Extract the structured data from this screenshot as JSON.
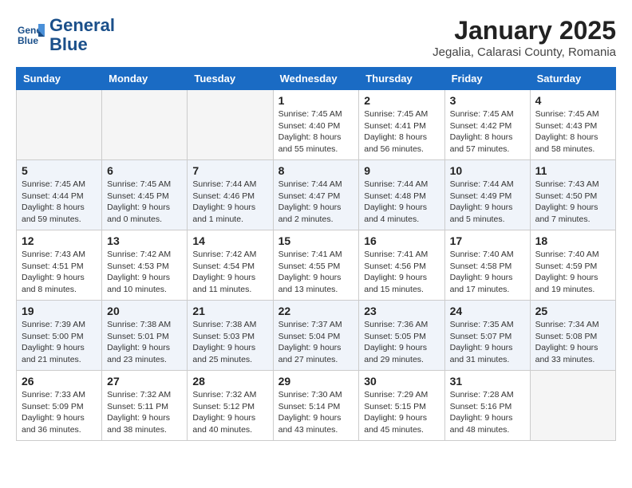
{
  "header": {
    "logo_line1": "General",
    "logo_line2": "Blue",
    "month": "January 2025",
    "location": "Jegalia, Calarasi County, Romania"
  },
  "weekdays": [
    "Sunday",
    "Monday",
    "Tuesday",
    "Wednesday",
    "Thursday",
    "Friday",
    "Saturday"
  ],
  "weeks": [
    [
      {
        "day": "",
        "info": ""
      },
      {
        "day": "",
        "info": ""
      },
      {
        "day": "",
        "info": ""
      },
      {
        "day": "1",
        "info": "Sunrise: 7:45 AM\nSunset: 4:40 PM\nDaylight: 8 hours\nand 55 minutes."
      },
      {
        "day": "2",
        "info": "Sunrise: 7:45 AM\nSunset: 4:41 PM\nDaylight: 8 hours\nand 56 minutes."
      },
      {
        "day": "3",
        "info": "Sunrise: 7:45 AM\nSunset: 4:42 PM\nDaylight: 8 hours\nand 57 minutes."
      },
      {
        "day": "4",
        "info": "Sunrise: 7:45 AM\nSunset: 4:43 PM\nDaylight: 8 hours\nand 58 minutes."
      }
    ],
    [
      {
        "day": "5",
        "info": "Sunrise: 7:45 AM\nSunset: 4:44 PM\nDaylight: 8 hours\nand 59 minutes."
      },
      {
        "day": "6",
        "info": "Sunrise: 7:45 AM\nSunset: 4:45 PM\nDaylight: 9 hours\nand 0 minutes."
      },
      {
        "day": "7",
        "info": "Sunrise: 7:44 AM\nSunset: 4:46 PM\nDaylight: 9 hours\nand 1 minute."
      },
      {
        "day": "8",
        "info": "Sunrise: 7:44 AM\nSunset: 4:47 PM\nDaylight: 9 hours\nand 2 minutes."
      },
      {
        "day": "9",
        "info": "Sunrise: 7:44 AM\nSunset: 4:48 PM\nDaylight: 9 hours\nand 4 minutes."
      },
      {
        "day": "10",
        "info": "Sunrise: 7:44 AM\nSunset: 4:49 PM\nDaylight: 9 hours\nand 5 minutes."
      },
      {
        "day": "11",
        "info": "Sunrise: 7:43 AM\nSunset: 4:50 PM\nDaylight: 9 hours\nand 7 minutes."
      }
    ],
    [
      {
        "day": "12",
        "info": "Sunrise: 7:43 AM\nSunset: 4:51 PM\nDaylight: 9 hours\nand 8 minutes."
      },
      {
        "day": "13",
        "info": "Sunrise: 7:42 AM\nSunset: 4:53 PM\nDaylight: 9 hours\nand 10 minutes."
      },
      {
        "day": "14",
        "info": "Sunrise: 7:42 AM\nSunset: 4:54 PM\nDaylight: 9 hours\nand 11 minutes."
      },
      {
        "day": "15",
        "info": "Sunrise: 7:41 AM\nSunset: 4:55 PM\nDaylight: 9 hours\nand 13 minutes."
      },
      {
        "day": "16",
        "info": "Sunrise: 7:41 AM\nSunset: 4:56 PM\nDaylight: 9 hours\nand 15 minutes."
      },
      {
        "day": "17",
        "info": "Sunrise: 7:40 AM\nSunset: 4:58 PM\nDaylight: 9 hours\nand 17 minutes."
      },
      {
        "day": "18",
        "info": "Sunrise: 7:40 AM\nSunset: 4:59 PM\nDaylight: 9 hours\nand 19 minutes."
      }
    ],
    [
      {
        "day": "19",
        "info": "Sunrise: 7:39 AM\nSunset: 5:00 PM\nDaylight: 9 hours\nand 21 minutes."
      },
      {
        "day": "20",
        "info": "Sunrise: 7:38 AM\nSunset: 5:01 PM\nDaylight: 9 hours\nand 23 minutes."
      },
      {
        "day": "21",
        "info": "Sunrise: 7:38 AM\nSunset: 5:03 PM\nDaylight: 9 hours\nand 25 minutes."
      },
      {
        "day": "22",
        "info": "Sunrise: 7:37 AM\nSunset: 5:04 PM\nDaylight: 9 hours\nand 27 minutes."
      },
      {
        "day": "23",
        "info": "Sunrise: 7:36 AM\nSunset: 5:05 PM\nDaylight: 9 hours\nand 29 minutes."
      },
      {
        "day": "24",
        "info": "Sunrise: 7:35 AM\nSunset: 5:07 PM\nDaylight: 9 hours\nand 31 minutes."
      },
      {
        "day": "25",
        "info": "Sunrise: 7:34 AM\nSunset: 5:08 PM\nDaylight: 9 hours\nand 33 minutes."
      }
    ],
    [
      {
        "day": "26",
        "info": "Sunrise: 7:33 AM\nSunset: 5:09 PM\nDaylight: 9 hours\nand 36 minutes."
      },
      {
        "day": "27",
        "info": "Sunrise: 7:32 AM\nSunset: 5:11 PM\nDaylight: 9 hours\nand 38 minutes."
      },
      {
        "day": "28",
        "info": "Sunrise: 7:32 AM\nSunset: 5:12 PM\nDaylight: 9 hours\nand 40 minutes."
      },
      {
        "day": "29",
        "info": "Sunrise: 7:30 AM\nSunset: 5:14 PM\nDaylight: 9 hours\nand 43 minutes."
      },
      {
        "day": "30",
        "info": "Sunrise: 7:29 AM\nSunset: 5:15 PM\nDaylight: 9 hours\nand 45 minutes."
      },
      {
        "day": "31",
        "info": "Sunrise: 7:28 AM\nSunset: 5:16 PM\nDaylight: 9 hours\nand 48 minutes."
      },
      {
        "day": "",
        "info": ""
      }
    ]
  ]
}
